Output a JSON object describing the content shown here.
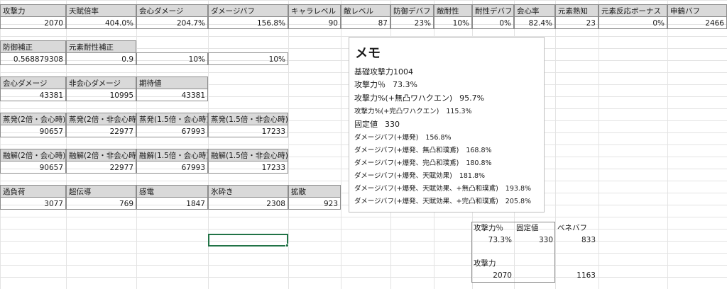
{
  "sheet": {
    "row1_headers": [
      "攻撃力",
      "天賦倍率",
      "会心ダメージ",
      "ダメージバフ",
      "キャラレベル",
      "敵レベル",
      "防御デバフ",
      "敵耐性",
      "耐性デバフ",
      "会心率",
      "元素熟知",
      "元素反応ボーナス",
      "申鶴バフ"
    ],
    "row1_values": [
      "2070",
      "404.0%",
      "204.7%",
      "156.8%",
      "90",
      "87",
      "23%",
      "10%",
      "0%",
      "82.4%",
      "23",
      "0%",
      "2466"
    ],
    "row2_headers": [
      "防御補正",
      "元素耐性補正"
    ],
    "row2_values": [
      "0.568879308",
      "0.9",
      "10%",
      "10%"
    ],
    "crit_headers": [
      "会心ダメージ",
      "非会心ダメージ",
      "期待値"
    ],
    "crit_values": [
      "43381",
      "10995",
      "43381"
    ],
    "vaporize_headers": [
      "蒸発(2倍・会心時)",
      "蒸発(2倍・非会心時)",
      "蒸発(1.5倍・会心時)",
      "蒸発(1.5倍・非会心時)"
    ],
    "vaporize_values": [
      "90657",
      "22977",
      "67993",
      "17233"
    ],
    "melt_headers": [
      "融解(2倍・会心時)",
      "融解(2倍・非会心時)",
      "融解(1.5倍・会心時)",
      "融解(1.5倍・非会心時)"
    ],
    "melt_values": [
      "90657",
      "22977",
      "67993",
      "17233"
    ],
    "reaction_headers": [
      "過負荷",
      "超伝導",
      "感電",
      "氷砕き",
      "拡散"
    ],
    "reaction_values": [
      "3077",
      "769",
      "1847",
      "2308",
      "923"
    ]
  },
  "memo": {
    "title": "メモ",
    "lines": [
      {
        "label": "基礎攻撃力1004",
        "value": ""
      },
      {
        "label": "攻撃力％",
        "value": "73.3%"
      },
      {
        "label": "攻撃力%(+無凸ワハクエン)",
        "value": "95.7%"
      },
      {
        "label": "攻撃力%(+完凸ワハクエン)",
        "value": "115.3%"
      },
      {
        "label": "固定値",
        "value": "330"
      },
      {
        "label": "ダメージバフ(+爆発)",
        "value": "156.8%"
      },
      {
        "label": "ダメージバフ(+爆発、無凸和璞鳶)",
        "value": "168.8%"
      },
      {
        "label": "ダメージバフ(+爆発、完凸和璞鳶)",
        "value": "180.8%"
      },
      {
        "label": "ダメージバフ(+爆発、天賦効果)",
        "value": "181.8%"
      },
      {
        "label": "ダメージバフ(+爆発、天賦効果、+無凸和璞鳶)",
        "value": "193.8%"
      },
      {
        "label": "ダメージバフ(+爆発、天賦効果、+完凸和璞鳶)",
        "value": "205.8%"
      }
    ]
  },
  "side": {
    "h1": "攻撃力％",
    "h2": "固定値",
    "h3": "ベネバフ",
    "v1": "73.3%",
    "v2": "330",
    "v3": "833",
    "label_atk": "攻撃力",
    "atk_value": "2070",
    "bene_total": "1163"
  }
}
